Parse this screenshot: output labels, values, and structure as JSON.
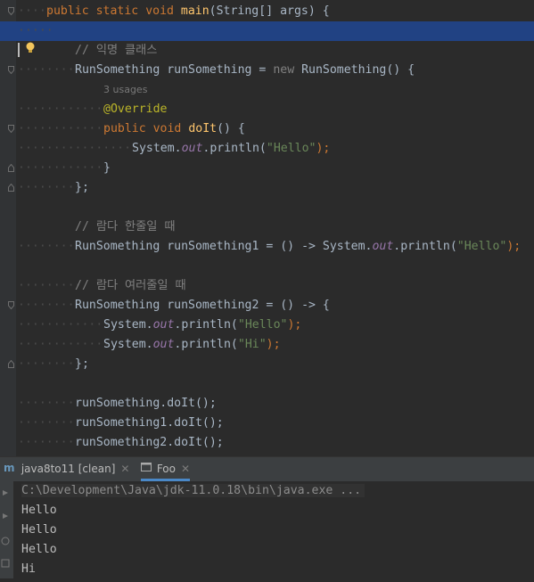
{
  "editor": {
    "lines": {
      "l1": [
        "public",
        "static",
        "void",
        "main",
        "(String[] args) {"
      ],
      "comment1": "// 익명 클래스",
      "l3": [
        "RunSomething runSomething = ",
        "new",
        " RunSomething() {"
      ],
      "usages": "3 usages",
      "override": "@Override",
      "l6": [
        "public",
        "void",
        "doIt",
        "() {"
      ],
      "l7": [
        "System.",
        "out",
        ".println(",
        "\"Hello\"",
        ");"
      ],
      "close1": "}",
      "close2": "};",
      "comment2": "// 람다 한줄일 때",
      "l11": [
        "RunSomething runSomething1 = () -> System.",
        "out",
        ".println(",
        "\"Hello\"",
        ");"
      ],
      "comment3": "// 람다 여러줄일 때",
      "l13": "RunSomething runSomething2 = () -> {",
      "l14": [
        "System.",
        "out",
        ".println(",
        "\"Hello\"",
        ");"
      ],
      "l15": [
        "System.",
        "out",
        ".println(",
        "\"Hi\"",
        ");"
      ],
      "close3": "};",
      "call1": "runSomething.doIt();",
      "call2": "runSomething1.doIt();",
      "call3": "runSomething2.doIt();"
    }
  },
  "run_tabs": [
    {
      "label": "java8to11 [clean]",
      "icon": "maven-icon"
    },
    {
      "label": "Foo",
      "icon": "run-config-icon"
    }
  ],
  "console": {
    "command": "C:\\Development\\Java\\jdk-11.0.18\\bin\\java.exe ...",
    "output": [
      "Hello",
      "Hello",
      "Hello",
      "Hi"
    ]
  },
  "colors": {
    "background": "#2b2b2b",
    "keyword": "#cc7832",
    "string": "#6a8759",
    "method": "#ffc66d",
    "field": "#9876aa",
    "selection": "#214283"
  }
}
